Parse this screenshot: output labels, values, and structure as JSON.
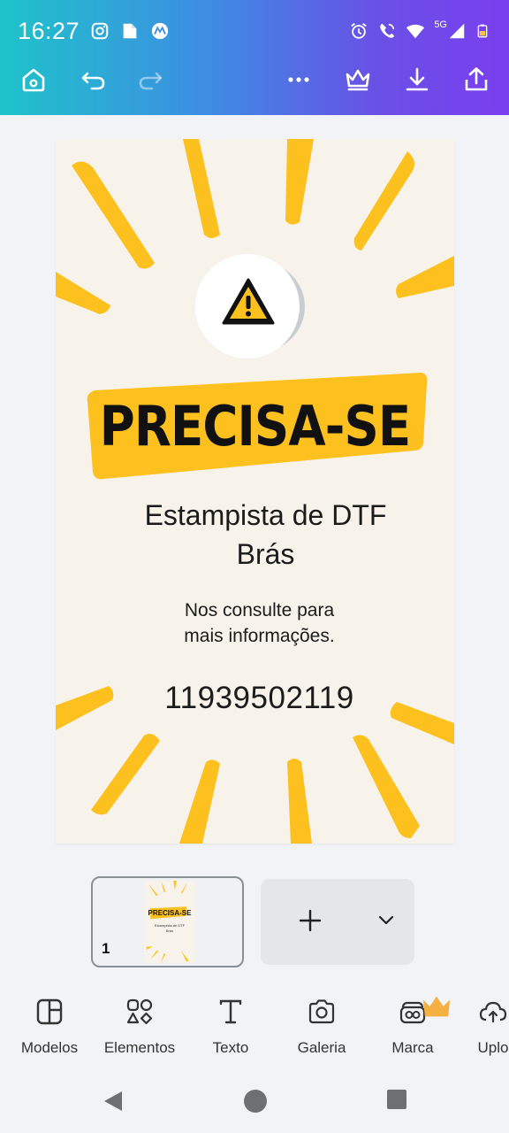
{
  "status_bar": {
    "time": "16:27",
    "app_icons": [
      "instagram-icon",
      "app-b-icon",
      "motorola-icon"
    ],
    "right_icons": [
      "alarm-icon",
      "wifi-call-icon",
      "wifi-icon",
      "signal-5g-icon",
      "battery-icon"
    ],
    "network_label": "5G"
  },
  "toolbar": {
    "buttons": [
      "home-icon",
      "undo-icon",
      "redo-icon",
      "more-icon",
      "crown-icon",
      "download-icon",
      "share-icon"
    ]
  },
  "design": {
    "headline": "PRECISA-SE",
    "job_line1": "Estampista de DTF",
    "job_line2": "Brás",
    "note_line1": "Nos consulte para",
    "note_line2": "mais informações.",
    "phone": "11939502119",
    "colors": {
      "accent": "#fdc11f",
      "background": "#f7f3ea",
      "text": "#111111"
    }
  },
  "pages": {
    "current_page_number": "1",
    "thumb_headline": "PRECISA-SE",
    "thumb_job": "Estampista de DTF",
    "thumb_job2": "Brás",
    "add_page_icon": "plus-icon",
    "expand_icon": "chevron-down-icon"
  },
  "bottom_tools": [
    {
      "label": "Modelos",
      "icon": "templates-icon"
    },
    {
      "label": "Elementos",
      "icon": "elements-icon"
    },
    {
      "label": "Texto",
      "icon": "text-icon"
    },
    {
      "label": "Galeria",
      "icon": "camera-icon"
    },
    {
      "label": "Marca",
      "icon": "brand-icon"
    },
    {
      "label": "Uplo",
      "icon": "cloud-upload-icon"
    }
  ],
  "nav_bar": [
    "back-icon",
    "home-circle-icon",
    "recents-icon"
  ],
  "theme": {
    "header_gradient_start": "#1ec3c9",
    "header_gradient_end": "#7a3ff0",
    "crown_color": "#f5b042"
  }
}
